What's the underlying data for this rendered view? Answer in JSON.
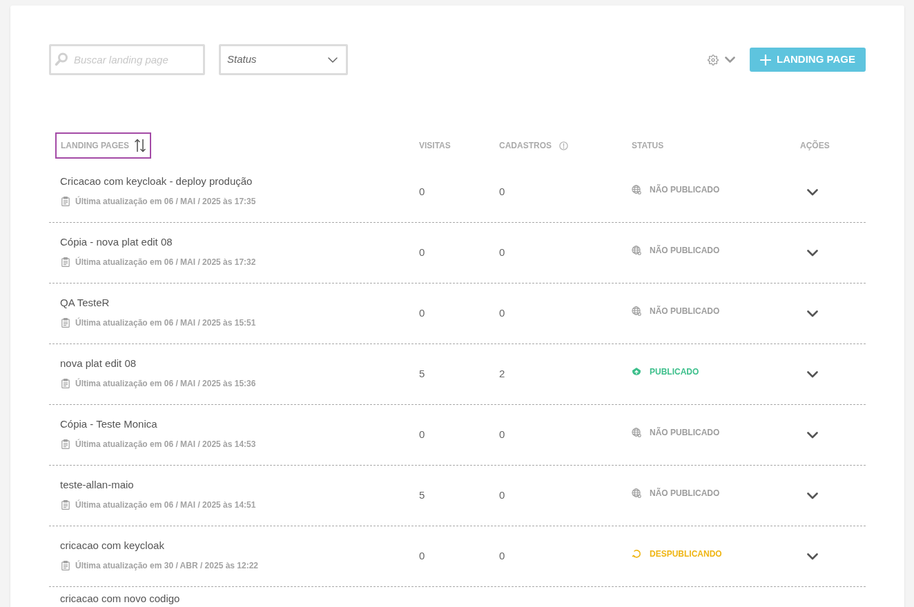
{
  "toolbar": {
    "search": {
      "placeholder": "Buscar landing page"
    },
    "status_filter": {
      "label": "Status"
    },
    "new_button": {
      "label": "LANDING PAGE"
    }
  },
  "table": {
    "columns": [
      {
        "label": "LANDING PAGES",
        "kind": "sortable",
        "focused": true
      },
      {
        "label": "VISITAS",
        "kind": "plain",
        "focused": false
      },
      {
        "label": "CADASTROS",
        "kind": "info",
        "focused": false
      },
      {
        "label": "STATUS",
        "kind": "plain",
        "focused": false
      },
      {
        "label": "AÇÕES",
        "kind": "plain",
        "focused": false
      }
    ],
    "rows": [
      {
        "name": "Cricacao com keycloak - deploy produção",
        "updated": "Última atualização em 06 / MAI / 2025 às 17:35",
        "visits": "0",
        "signups": "0",
        "status": {
          "kind": "unpublished",
          "label": "NÃO PUBLICADO"
        }
      },
      {
        "name": "Cópia - nova plat edit 08",
        "updated": "Última atualização em 06 / MAI / 2025 às 17:32",
        "visits": "0",
        "signups": "0",
        "status": {
          "kind": "unpublished",
          "label": "NÃO PUBLICADO"
        }
      },
      {
        "name": "QA TesteR",
        "updated": "Última atualização em 06 / MAI / 2025 às 15:51",
        "visits": "0",
        "signups": "0",
        "status": {
          "kind": "unpublished",
          "label": "NÃO PUBLICADO"
        }
      },
      {
        "name": "nova plat edit 08",
        "updated": "Última atualização em 06 / MAI / 2025 às 15:36",
        "visits": "5",
        "signups": "2",
        "status": {
          "kind": "published",
          "label": "PUBLICADO"
        }
      },
      {
        "name": "Cópia - Teste Monica",
        "updated": "Última atualização em 06 / MAI / 2025 às 14:53",
        "visits": "0",
        "signups": "0",
        "status": {
          "kind": "unpublished",
          "label": "NÃO PUBLICADO"
        }
      },
      {
        "name": "teste-allan-maio",
        "updated": "Última atualização em 06 / MAI / 2025 às 14:51",
        "visits": "5",
        "signups": "0",
        "status": {
          "kind": "unpublished",
          "label": "NÃO PUBLICADO"
        }
      },
      {
        "name": "cricacao com keycloak",
        "updated": "Última atualização em 30 / ABR / 2025 às 12:22",
        "visits": "0",
        "signups": "0",
        "status": {
          "kind": "unpublishing",
          "label": "DESPUBLICANDO"
        }
      },
      {
        "name": "cricacao com novo codigo"
      }
    ]
  }
}
